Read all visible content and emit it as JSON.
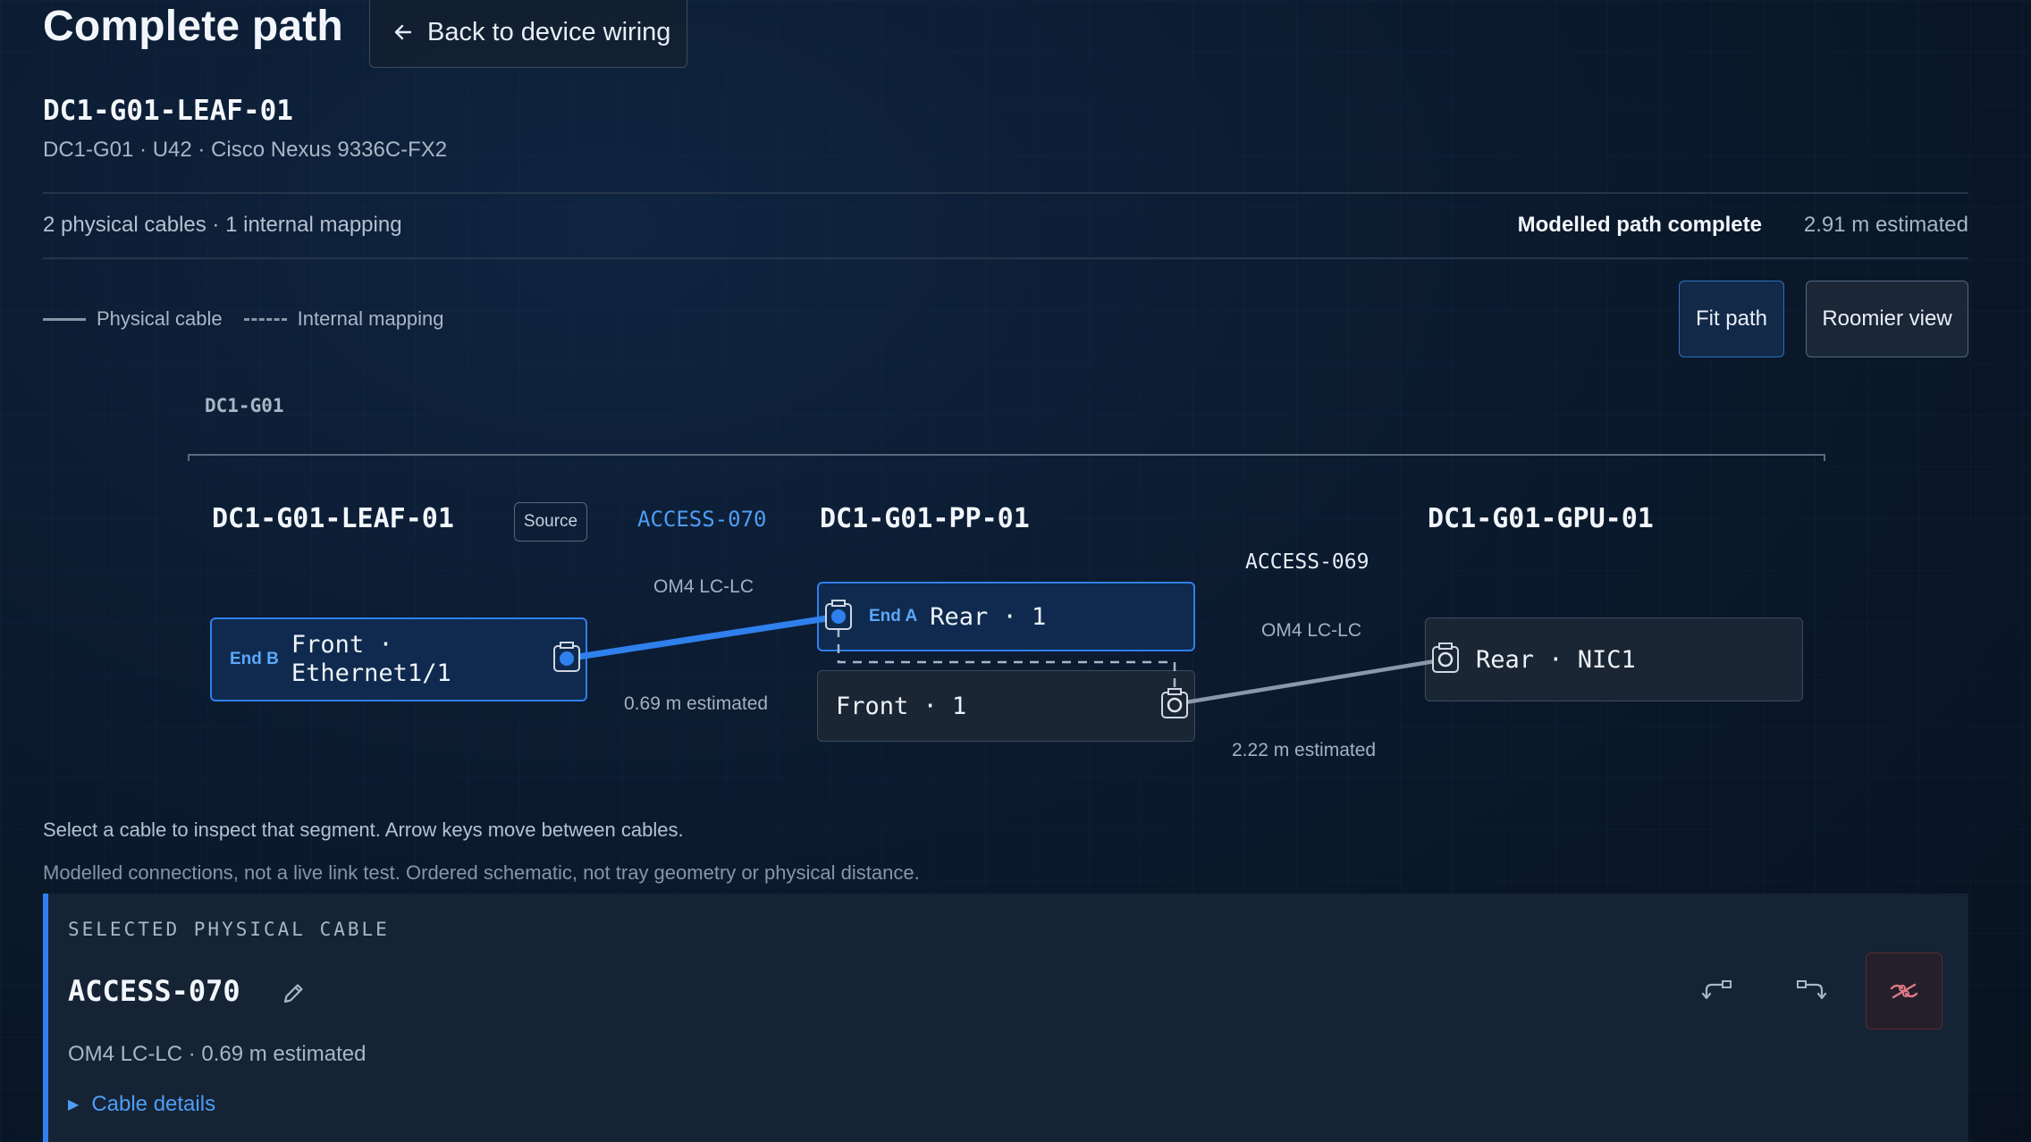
{
  "header": {
    "title": "Complete path",
    "back_label": "Back to device wiring"
  },
  "device": {
    "name": "DC1-G01-LEAF-01",
    "subtitle": "DC1-G01 · U42 · Cisco Nexus 9336C-FX2"
  },
  "summary": {
    "counts": "2 physical cables · 1 internal mapping",
    "status": "Modelled path complete",
    "estimate": "2.91 m estimated"
  },
  "legend": {
    "physical": "Physical cable",
    "internal": "Internal mapping"
  },
  "view_buttons": {
    "fit": "Fit path",
    "roomier": "Roomier view"
  },
  "diagram": {
    "group": "DC1-G01",
    "source_badge": "Source",
    "nodes": {
      "leaf": {
        "title": "DC1-G01-LEAF-01",
        "port_end": "End B",
        "port_line1": "Front ·",
        "port_line2": "Ethernet1/1"
      },
      "pp": {
        "title": "DC1-G01-PP-01",
        "rear_end": "End A",
        "rear_label": "Rear · 1",
        "front_label": "Front · 1"
      },
      "gpu": {
        "title": "DC1-G01-GPU-01",
        "port_label": "Rear · NIC1"
      }
    },
    "cables": [
      {
        "id": "ACCESS-070",
        "type": "OM4 LC-LC",
        "length": "0.69 m estimated",
        "color": "#2f80ed"
      },
      {
        "id": "ACCESS-069",
        "type": "OM4 LC-LC",
        "length": "2.22 m estimated",
        "color": "#8a98aa"
      }
    ]
  },
  "hint": "Select a cable to inspect that segment. Arrow keys move between cables.",
  "note": "Modelled connections, not a live link test. Ordered schematic, not tray geometry or physical distance.",
  "panel": {
    "label": "SELECTED PHYSICAL CABLE",
    "title": "ACCESS-070",
    "subtitle": "OM4 LC-LC · 0.69 m estimated",
    "details_label": "Cable details",
    "icons": [
      "edit-icon",
      "reroute-left-icon",
      "reroute-right-icon",
      "disconnect-icon"
    ]
  }
}
